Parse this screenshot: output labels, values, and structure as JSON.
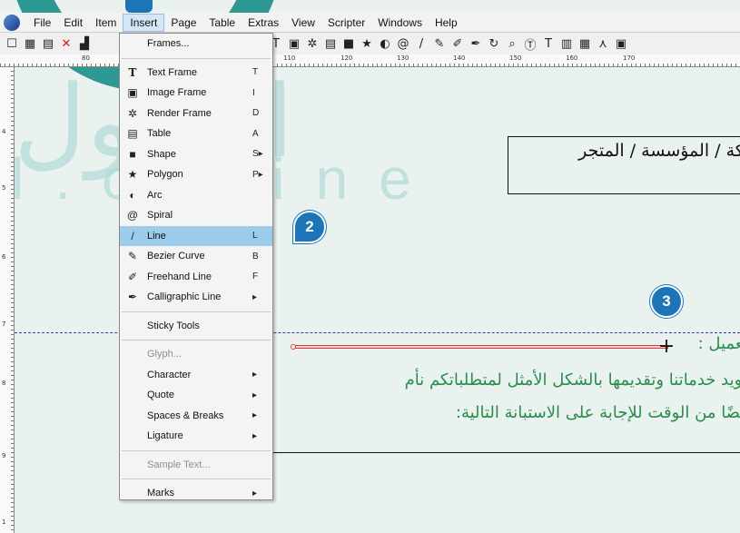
{
  "watermark": {
    "arabic": "الحلول",
    "latin": "l.online"
  },
  "menubar": {
    "items": [
      "File",
      "Edit",
      "Item",
      "Insert",
      "Page",
      "Table",
      "Extras",
      "View",
      "Scripter",
      "Windows",
      "Help"
    ],
    "active": "Insert"
  },
  "insert_menu": {
    "frames": "Frames...",
    "text_frame": {
      "label": "Text Frame",
      "shortcut": "T"
    },
    "image_frame": {
      "label": "Image Frame",
      "shortcut": "I"
    },
    "render_frame": {
      "label": "Render Frame",
      "shortcut": "D"
    },
    "table": {
      "label": "Table",
      "shortcut": "A"
    },
    "shape": {
      "label": "Shape",
      "shortcut": "S▸"
    },
    "polygon": {
      "label": "Polygon",
      "shortcut": "P▸"
    },
    "arc": {
      "label": "Arc",
      "shortcut": ""
    },
    "spiral": {
      "label": "Spiral",
      "shortcut": ""
    },
    "line": {
      "label": "Line",
      "shortcut": "L"
    },
    "bezier": {
      "label": "Bezier Curve",
      "shortcut": "B"
    },
    "freehand": {
      "label": "Freehand Line",
      "shortcut": "F"
    },
    "calligraphic": {
      "label": "Calligraphic Line",
      "shortcut": "▸"
    },
    "sticky_tools": "Sticky Tools",
    "glyph": "Glyph...",
    "character": "Character",
    "quote": "Quote",
    "spaces_breaks": "Spaces & Breaks",
    "ligature": "Ligature",
    "sample_text": "Sample Text...",
    "marks": "Marks",
    "submenu_arrow": "▸"
  },
  "ruler": {
    "h_ticks": [
      "80",
      "110",
      "120",
      "130",
      "140",
      "150",
      "160",
      "170"
    ],
    "v_ticks": [
      "4",
      "5",
      "6",
      "7",
      "8",
      "9",
      "1"
    ]
  },
  "document": {
    "company_text": "ركة / المؤسسة / المتجر",
    "customer_label": "العميل :",
    "line2": "جويد خدماتنا وتقديمها بالشكل الأمثل لمتطلباتكم نأم",
    "line3": "بعضًا من الوقت للإجابة على الاستبانة التالية:"
  },
  "callouts": {
    "two": "2",
    "three": "3"
  },
  "colors": {
    "accent": "#1d75b8",
    "highlight": "#9ccbeb",
    "line": "#e13b3b",
    "body_text": "#2a8d4e"
  }
}
